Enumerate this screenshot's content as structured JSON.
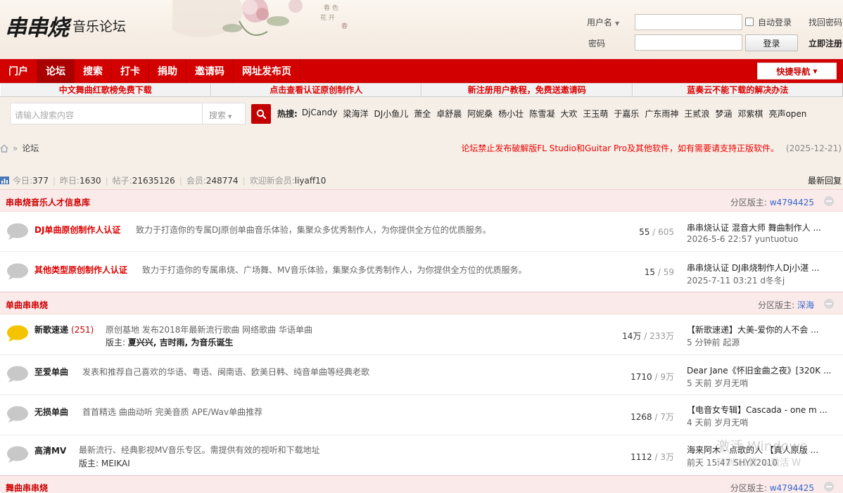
{
  "header": {
    "logo_mark": "串串烧",
    "logo_text": "音乐论坛",
    "login": {
      "username_label": "用户名",
      "password_label": "密码",
      "auto_login": "自动登录",
      "login_button": "登录",
      "find_password": "找回密码",
      "register": "立即注册"
    }
  },
  "nav": {
    "items": [
      "门户",
      "论坛",
      "搜索",
      "打卡",
      "捐助",
      "邀请码",
      "网址发布页"
    ],
    "quick_nav": "快捷导航"
  },
  "notice": [
    "中文舞曲红歌榜免费下载",
    "点击查看认证原创制作人",
    "新注册用户教程，免费送邀请码",
    "蓝奏云不能下载的解决办法"
  ],
  "search": {
    "placeholder": "请输入搜索内容",
    "type": "搜索",
    "hot_label": "热搜:",
    "hot_words": [
      "DjCandy",
      "梁海洋",
      "DJ小鱼儿",
      "萧全",
      "卓舒晨",
      "阿妮桑",
      "杨小壮",
      "陈雪凝",
      "大欢",
      "王玉萌",
      "于嘉乐",
      "广东雨神",
      "王贰浪",
      "梦涵",
      "邓紫棋",
      "亮声open"
    ]
  },
  "breadcrumb": {
    "home_icon": "home-icon",
    "current": "论坛"
  },
  "announcement": {
    "text": "论坛禁止发布破解版FL Studio和Guitar Pro及其他软件，如有需要请支持正版软件。",
    "date": "(2025-12-21)"
  },
  "stats": {
    "today_label": "今日:",
    "today": "377",
    "yesterday_label": "昨日:",
    "yesterday": "1630",
    "posts_label": "帖子:",
    "posts": "21635126",
    "members_label": "会员:",
    "members": "248774",
    "welcome_label": "欢迎新会员:",
    "newest": "liyaff10",
    "latest_reply": "最新回复"
  },
  "sections": [
    {
      "title": "串串烧音乐人才信息库",
      "mod_label": "分区版主:",
      "mod": "w4794425",
      "forums": [
        {
          "name": "DJ单曲原创制作人认证",
          "desc": "致力于打造你的专属DJ原创单曲音乐体验，集聚众多优秀制作人，为你提供全方位的优质服务。",
          "threads": "55",
          "posts": "605",
          "last_title": "串串烧认证 混音大师 舞曲制作人 ...",
          "last_meta": "2026-5-6 22:57 yuntuotuo"
        },
        {
          "name": "其他类型原创制作人认证",
          "desc": "致力于打造你的专属串烧、广场舞、MV音乐体验，集聚众多优秀制作人，为你提供全方位的优质服务。",
          "threads": "15",
          "posts": "59",
          "last_title": "串串烧认证 DJ串烧制作人Dj小湛 ...",
          "last_meta": "2025-7-11 03:21 d冬冬j"
        }
      ]
    },
    {
      "title": "单曲串串烧",
      "mod_label": "分区版主:",
      "mod": "深海",
      "forums": [
        {
          "name": "新歌速递",
          "count": "(251)",
          "desc": "原创基地 发布2018年最新流行歌曲 网络歌曲 华语单曲",
          "mods_label": "版主:",
          "mods": "夏兴兴, 吉时雨, 为音乐诞生",
          "threads": "14万",
          "posts": "233万",
          "last_title": "【新歌速递】大美-爱你的人不会 ...",
          "last_meta": "5 分钟前 起源"
        },
        {
          "name": "至爱单曲",
          "desc": "发表和推荐自己喜欢的华语、粤语、闽南语、欧美日韩、纯音单曲等经典老歌",
          "threads": "1710",
          "posts": "9万",
          "last_title": "Dear Jane《怀旧金曲之夜》[320K ...",
          "last_meta": "5 天前 岁月无哨"
        },
        {
          "name": "无损单曲",
          "desc": "首首精选 曲曲动听 完美音质 APE/Wav单曲推荐",
          "threads": "1268",
          "posts": "7万",
          "last_title": "【电音女专辑】Cascada - one m ...",
          "last_meta": "4 天前 岁月无哨"
        },
        {
          "name": "高清MV",
          "desc": "最新流行、经典影视MV音乐专区。需提供有效的视听和下载地址",
          "mods_label": "版主:",
          "mods": "MEIKAI",
          "threads": "1112",
          "posts": "3万",
          "last_title": "海来阿木 - 点歌的人 【真人原版 ...",
          "last_meta": "前天 15:47 SHYX2010"
        }
      ]
    },
    {
      "title": "舞曲串串烧",
      "mod_label": "分区版主:",
      "mod": "w4794425"
    }
  ],
  "os_watermark": {
    "line1": "激活 Windows",
    "line2": "转到\"设置\"以激活 W"
  },
  "colors": {
    "brand_red": "#d30000",
    "link_blue": "#3366cc",
    "new_forum_yellow": "#f5c400"
  }
}
